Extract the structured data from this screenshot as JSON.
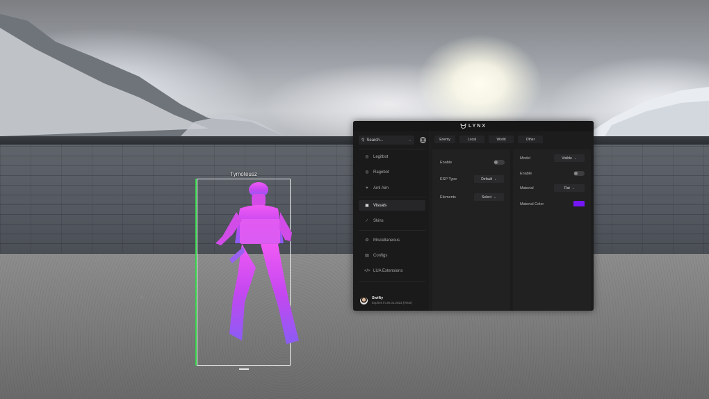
{
  "esp": {
    "player_name": "Tymoteusz",
    "health_color": "#35d04a",
    "chams_color": "#e03cf0"
  },
  "menu": {
    "logo_text": "LYNX",
    "search": {
      "placeholder": "Search..."
    },
    "nav": [
      {
        "label": "Legitbot",
        "icon": "crosshair-icon"
      },
      {
        "label": "Ragebot",
        "icon": "target-icon"
      },
      {
        "label": "Anti Aim",
        "icon": "arrows-icon"
      },
      {
        "label": "Visuals",
        "icon": "image-icon",
        "active": true
      },
      {
        "label": "Skins",
        "icon": "brush-icon"
      },
      {
        "label": "Miscellaneous",
        "icon": "gear-icon"
      },
      {
        "label": "Configs",
        "icon": "save-icon"
      },
      {
        "label": "LUA Extensions",
        "icon": "code-icon"
      }
    ],
    "user": {
      "name": "Swifty",
      "expires": "Expires in 26.01.2023 (Visor)"
    },
    "tabs": [
      "Enemy",
      "Local",
      "World",
      "Other"
    ],
    "left_panel": {
      "enable_label": "Enable",
      "esp_type_label": "ESP Type",
      "esp_type_value": "Default",
      "elements_label": "Elements",
      "elements_value": "Select"
    },
    "right_panel": {
      "model_label": "Model",
      "model_value": "Visible",
      "enable_label": "Enable",
      "material_label": "Material",
      "material_value": "Flat",
      "material_color_label": "Material Color",
      "material_color": "#7416f5"
    }
  }
}
